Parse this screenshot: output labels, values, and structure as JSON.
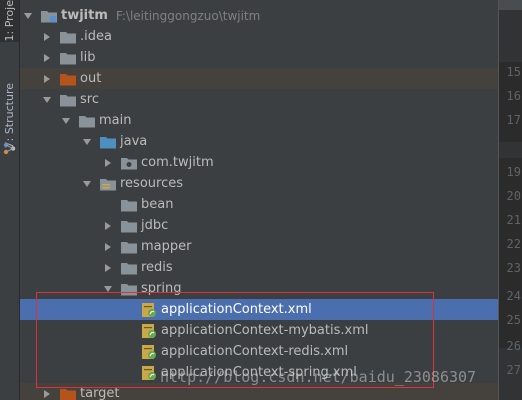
{
  "side_tabs": {
    "project": "1: Proje",
    "structure": "7: Structure"
  },
  "tree": {
    "root": {
      "name": "twjitm",
      "path": "F:\\leitinggongzuo\\twjitm"
    },
    "items": [
      {
        "label": ".idea"
      },
      {
        "label": "lib"
      },
      {
        "label": "out"
      },
      {
        "label": "src"
      },
      {
        "label": "main"
      },
      {
        "label": "java"
      },
      {
        "label": "com.twjitm"
      },
      {
        "label": "resources"
      },
      {
        "label": "bean"
      },
      {
        "label": "jdbc"
      },
      {
        "label": "mapper"
      },
      {
        "label": "redis"
      },
      {
        "label": "spring"
      },
      {
        "label": "applicationContext.xml"
      },
      {
        "label": "applicationContext-mybatis.xml"
      },
      {
        "label": "applicationContext-redis.xml"
      },
      {
        "label": "applicationContext-spring.xml"
      },
      {
        "label": "target"
      }
    ]
  },
  "gutter": {
    "line_numbers": [
      "15",
      "16",
      "17",
      "19",
      "20",
      "21",
      "22",
      "23",
      "24",
      "25",
      "26",
      "27"
    ]
  },
  "watermark": "http://blog.csdn.net/baidu_23086307",
  "colors": {
    "selection": "#4b6eaf",
    "highlight_box": "#d9343e",
    "folder": "#8a9299",
    "excluded_folder": "#b4541c"
  }
}
